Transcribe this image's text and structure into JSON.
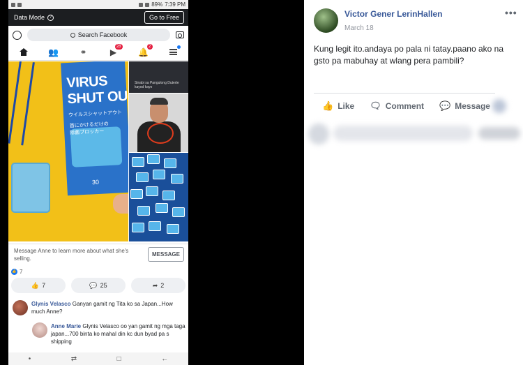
{
  "phone": {
    "status_bar": {
      "battery": "89%",
      "time": "7:39 PM"
    },
    "data_mode": {
      "label": "Data Mode",
      "help": "?",
      "go_to_free": "Go to Free"
    },
    "search": {
      "placeholder": "Search Facebook"
    },
    "nav": {
      "items": [
        {
          "name": "home",
          "icon": "home-icon"
        },
        {
          "name": "friends",
          "icon": "friends-icon"
        },
        {
          "name": "messenger",
          "icon": "messenger-icon"
        },
        {
          "name": "watch",
          "icon": "watch-icon",
          "badge": "28"
        },
        {
          "name": "notifications",
          "icon": "bell-icon",
          "badge": "2"
        },
        {
          "name": "menu",
          "icon": "menu-icon"
        }
      ]
    },
    "photo_text": {
      "box_title": "VIRUS\nSHUT OU",
      "box_sub": "ウイルスシャットアウト",
      "box_mid": "首にかけるだけの\n除菌ブロッカー",
      "box_num": "30",
      "tv_text": "Sinabi sa Pangulong Duterte\nkayod kayo"
    },
    "message_prompt": "Message Anne to learn more about what she's selling.",
    "message_button": "MESSAGE",
    "reactions": {
      "count": "7"
    },
    "actions": {
      "likes": "7",
      "comments": "25",
      "shares": "2"
    },
    "comments": [
      {
        "name": "Glynis Velasco",
        "text": "Ganyan gamit ng Tita ko sa Japan...How much Anne?"
      },
      {
        "name": "Anne Marie",
        "text": "Glynis Velasco oo yan gamit ng mga taga japan...700 binta ko mahal din kc dun byad pa s shipping"
      }
    ]
  },
  "post": {
    "author": "Victor Gener LerinHallen",
    "date": "March 18",
    "more": "•••",
    "text": "Kung legit ito.andaya po pala ni tatay.paano ako na gsto pa mabuhay at wlang pera pambili?",
    "actions": {
      "like": "Like",
      "comment": "Comment",
      "message": "Message"
    }
  },
  "colors": {
    "facebook_blue": "#385898",
    "badge_red": "#e41e3f",
    "data_mode_bar": "#1c1e21"
  }
}
